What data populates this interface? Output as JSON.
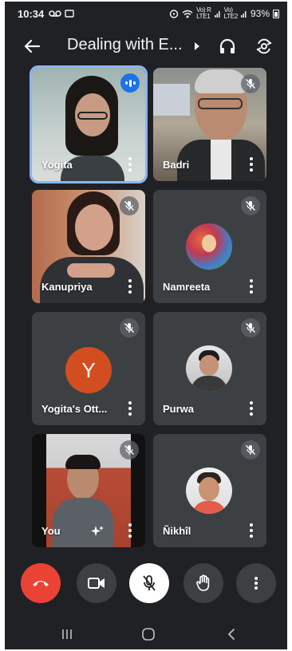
{
  "status_bar": {
    "time": "10:34",
    "network_label_1": "Vo) R\nLTE1",
    "network_label_2": "Vo)\nLTE2",
    "battery": "93%"
  },
  "top_bar": {
    "title": "Dealing with E...",
    "icons": [
      "back-arrow-icon",
      "chevron-right-icon",
      "headphones-icon",
      "camera-flip-icon"
    ]
  },
  "participants": [
    {
      "name": "Yogita",
      "type": "video",
      "speaking": true
    },
    {
      "name": "Badri",
      "type": "video",
      "muted": true
    },
    {
      "name": "Kanupriya",
      "type": "video",
      "muted": true
    },
    {
      "name": "Namreeta",
      "type": "avatar-image",
      "muted": true
    },
    {
      "name": "Yogita's Ott...",
      "type": "avatar-letter",
      "letter": "Y",
      "muted": true
    },
    {
      "name": "Purwa",
      "type": "avatar-image",
      "muted": true
    },
    {
      "name": "You",
      "type": "video",
      "muted": true
    },
    {
      "name": "Ñikhîl",
      "type": "avatar-image",
      "muted": true
    }
  ],
  "controls": [
    "end-call-button",
    "camera-button",
    "mic-button",
    "raise-hand-button",
    "more-options-button"
  ],
  "colors": {
    "background": "#202124",
    "tile": "#3c4043",
    "end_call": "#ea4335",
    "active_border": "#8ab4f8",
    "speaking": "#1a73e8",
    "avatar_letter_bg": "#d24e21"
  }
}
